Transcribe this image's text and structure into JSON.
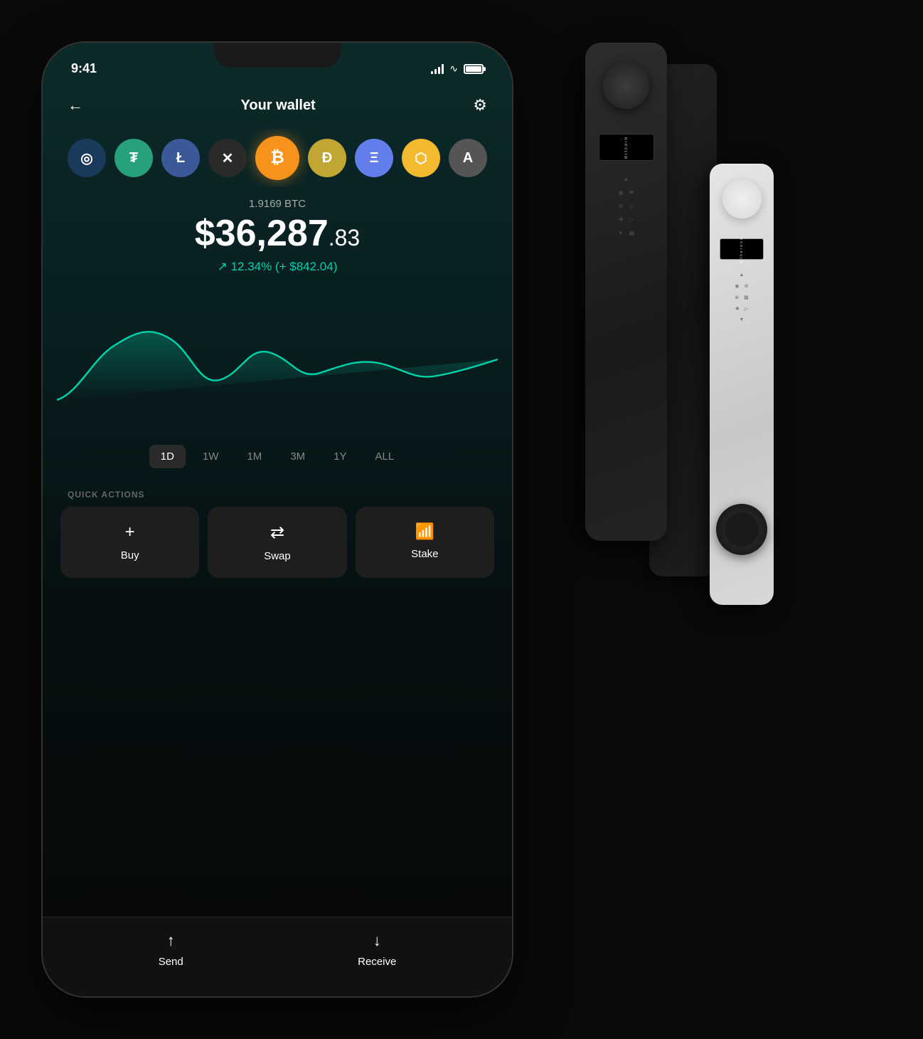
{
  "statusBar": {
    "time": "9:41",
    "signal": "●●●●",
    "wifi": "wifi",
    "battery": "full"
  },
  "header": {
    "back_label": "←",
    "title": "Your wallet",
    "settings_label": "⚙"
  },
  "coins": [
    {
      "id": "other",
      "symbol": "◎",
      "class": "coin-other"
    },
    {
      "id": "tether",
      "symbol": "₮",
      "class": "coin-tether"
    },
    {
      "id": "litecoin",
      "symbol": "Ł",
      "class": "coin-litecoin"
    },
    {
      "id": "xrp",
      "symbol": "✕",
      "class": "coin-xrp"
    },
    {
      "id": "bitcoin",
      "symbol": "₿",
      "class": "coin-bitcoin"
    },
    {
      "id": "doge",
      "symbol": "Ð",
      "class": "coin-doge"
    },
    {
      "id": "ethereum",
      "symbol": "Ξ",
      "class": "coin-eth"
    },
    {
      "id": "bnb",
      "symbol": "⬡",
      "class": "coin-bnb"
    },
    {
      "id": "algo",
      "symbol": "A",
      "class": "coin-algo"
    }
  ],
  "balance": {
    "crypto_amount": "1.9169 BTC",
    "fiat_whole": "$36,287",
    "fiat_cents": ".83",
    "change_text": "↗ 12.34% (+ $842.04)"
  },
  "timeFilters": [
    {
      "label": "1D",
      "active": true
    },
    {
      "label": "1W",
      "active": false
    },
    {
      "label": "1M",
      "active": false
    },
    {
      "label": "3M",
      "active": false
    },
    {
      "label": "1Y",
      "active": false
    },
    {
      "label": "ALL",
      "active": false
    }
  ],
  "quickActions": {
    "label": "QUICK ACTIONS",
    "buttons": [
      {
        "id": "buy",
        "icon": "+",
        "label": "Buy"
      },
      {
        "id": "swap",
        "icon": "⇄",
        "label": "Swap"
      },
      {
        "id": "stake",
        "icon": "📶",
        "label": "Stake"
      }
    ]
  },
  "bottomActions": [
    {
      "id": "send",
      "icon": "↑",
      "label": "Send"
    },
    {
      "id": "receive",
      "icon": "↓",
      "label": "Receive"
    }
  ],
  "hardwareWallets": {
    "nano_x_screen_text": "Bitcoin",
    "nano_s_screen_text": "Ethereum"
  }
}
